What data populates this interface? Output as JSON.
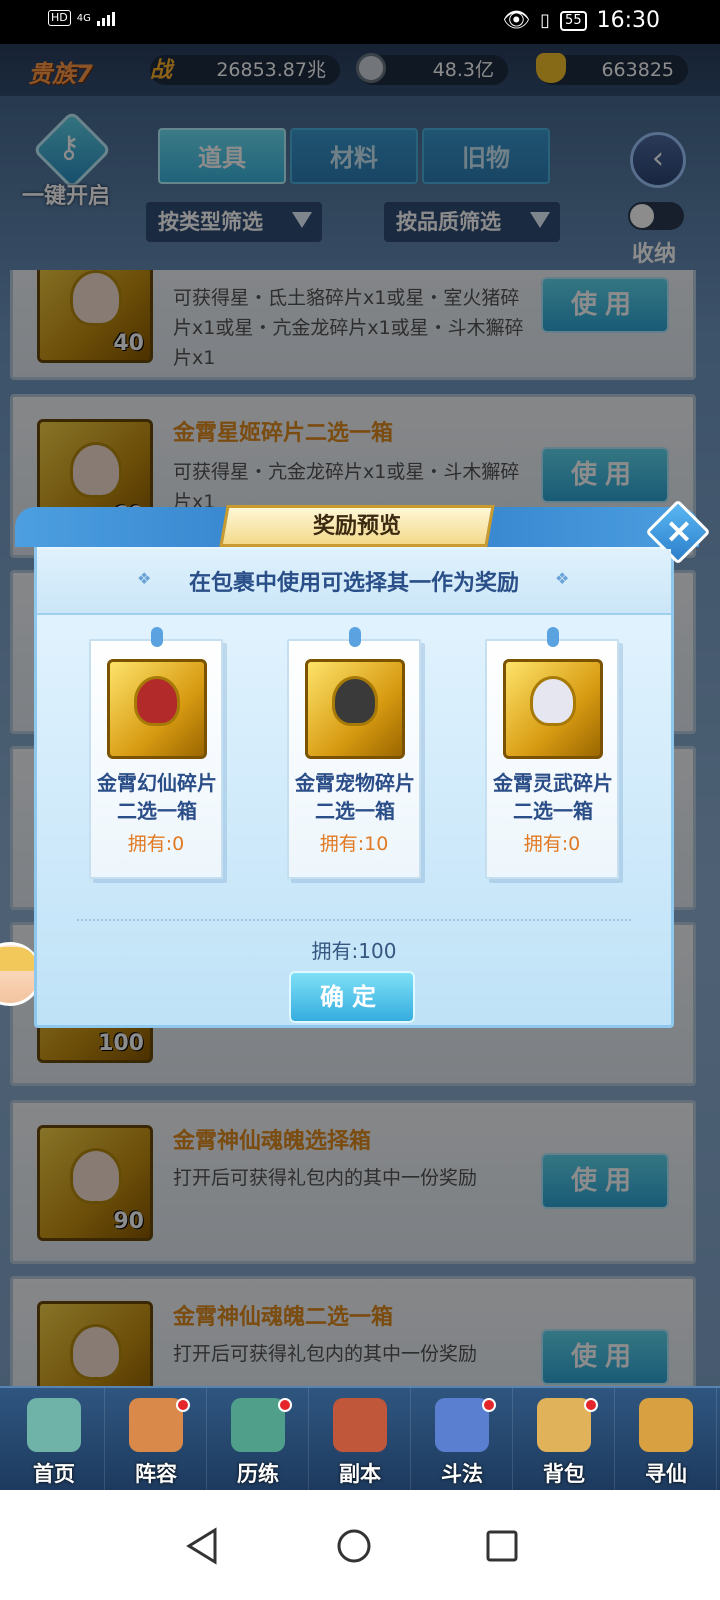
{
  "status_bar": {
    "hd": "HD",
    "network": "4G",
    "battery": "55",
    "time": "16:30"
  },
  "resources": {
    "noble": "贵族7",
    "power_icon_label": "战",
    "power": "26853.87兆",
    "coins": "48.3亿",
    "gold": "663825"
  },
  "header": {
    "one_key_open": "一键开启",
    "tabs": [
      "道具",
      "材料",
      "旧物"
    ],
    "active_tab": 0,
    "filter_type": "按类型筛选",
    "filter_quality": "按品质筛选",
    "collapse": "收纳"
  },
  "items": [
    {
      "title": "",
      "desc": "可获得星・氐土貉碎片x1或星・室火猪碎片x1或星・亢金龙碎片x1或星・斗木獬碎片x1",
      "qty": "40",
      "use": "使用"
    },
    {
      "title": "金霄星姬碎片二选一箱",
      "desc": "可获得星・亢金龙碎片x1或星・斗木獬碎片x1",
      "qty": "60",
      "use": "使用"
    },
    {
      "title": "",
      "desc": "",
      "qty": "100",
      "use": ""
    },
    {
      "title": "金霄神仙魂魄选择箱",
      "desc": "打开后可获得礼包内的其中一份奖励",
      "qty": "90",
      "use": "使用"
    },
    {
      "title": "金霄神仙魂魄二选一箱",
      "desc": "打开后可获得礼包内的其中一份奖励",
      "qty": "",
      "use": "使用"
    }
  ],
  "modal": {
    "title": "奖励预览",
    "subtitle": "在包裹中使用可选择其一作为奖励",
    "rewards": [
      {
        "name": "金霄幻仙碎片二选一箱",
        "owned": "拥有:0",
        "face_color": "#b32a2a"
      },
      {
        "name": "金霄宠物碎片二选一箱",
        "owned": "拥有:10",
        "face_color": "#3a3a3a"
      },
      {
        "name": "金霄灵武碎片二选一箱",
        "owned": "拥有:0",
        "face_color": "#e6e6f0"
      }
    ],
    "total_owned": "拥有:100",
    "confirm": "确定"
  },
  "bottom_nav": [
    {
      "label": "首页",
      "color": "#6fb2a8",
      "dot": false
    },
    {
      "label": "阵容",
      "color": "#d98a4a",
      "dot": true
    },
    {
      "label": "历练",
      "color": "#4f9f8a",
      "dot": true
    },
    {
      "label": "副本",
      "color": "#c0563a",
      "dot": false
    },
    {
      "label": "斗法",
      "color": "#5a7fd0",
      "dot": true
    },
    {
      "label": "背包",
      "color": "#e0b25a",
      "dot": true
    },
    {
      "label": "寻仙",
      "color": "#d8a040",
      "dot": false
    }
  ],
  "colors": {
    "accent": "#3bb6df",
    "title_orange": "#e08a1e",
    "owned_orange": "#e27a24"
  }
}
